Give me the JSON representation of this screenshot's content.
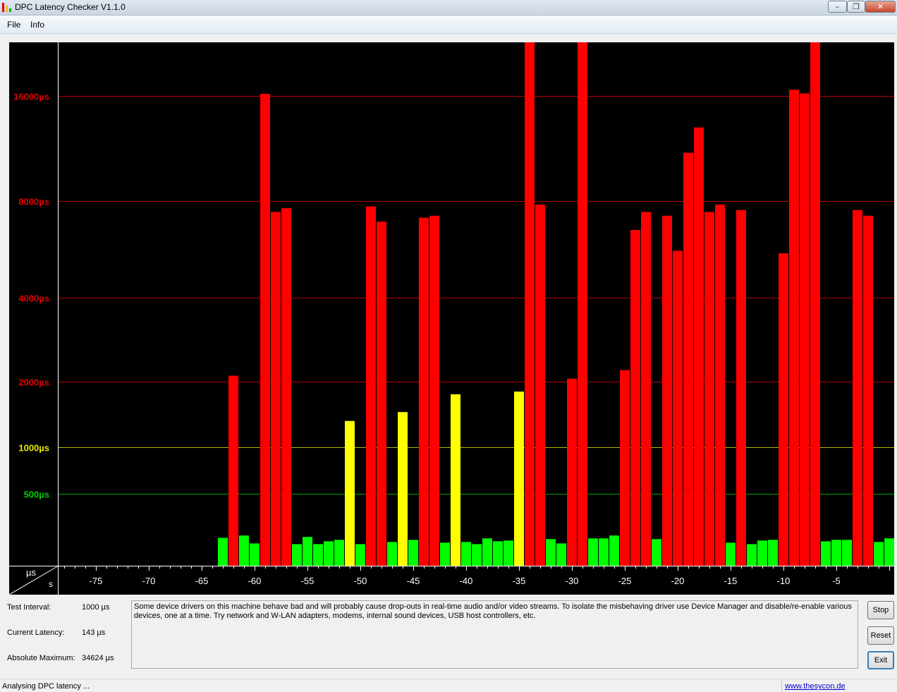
{
  "window": {
    "title": "DPC Latency Checker V1.1.0",
    "minimize_icon": "minimize-icon",
    "maximize_icon": "restore-icon",
    "close_icon": "close-icon"
  },
  "menu": {
    "items": [
      "File",
      "Info"
    ]
  },
  "chart_data": {
    "type": "bar",
    "title": "",
    "xlabel": "s",
    "ylabel": "µs",
    "x_ticks": [
      -75,
      -70,
      -65,
      -60,
      -55,
      -50,
      -45,
      -40,
      -35,
      -30,
      -25,
      -20,
      -15,
      -10,
      -5
    ],
    "y_ticks": [
      {
        "value": 500,
        "label": "500µs",
        "color": "#00cc00"
      },
      {
        "value": 1000,
        "label": "1000µs",
        "color": "#e8e800"
      },
      {
        "value": 2000,
        "label": "2000µs",
        "color": "#e00000"
      },
      {
        "value": 4000,
        "label": "4000µs",
        "color": "#e00000"
      },
      {
        "value": 8000,
        "label": "8000µs",
        "color": "#e00000"
      },
      {
        "value": 16000,
        "label": "16000µs",
        "color": "#e00000"
      }
    ],
    "xlim": [
      -79,
      0
    ],
    "ylim": [
      0,
      34624
    ],
    "grid": true,
    "color_thresholds": {
      "green_max": 1000,
      "yellow_max": 2000,
      "green": "#00ff00",
      "yellow": "#ffff00",
      "red": "#ff0000"
    },
    "x": [
      -63,
      -62,
      -61,
      -60,
      -59,
      -58,
      -57,
      -56,
      -55,
      -54,
      -53,
      -52,
      -51,
      -50,
      -49,
      -48,
      -47,
      -46,
      -45,
      -44,
      -43,
      -42,
      -41,
      -40,
      -39,
      -38,
      -37,
      -36,
      -35,
      -34,
      -33,
      -32,
      -31,
      -30,
      -29,
      -28,
      -27,
      -26,
      -25,
      -24,
      -23,
      -22,
      -21,
      -20,
      -19,
      -18,
      -17,
      -16,
      -15,
      -14,
      -13,
      -12,
      -11,
      -10,
      -9,
      -8,
      -7,
      -6,
      -5,
      -4,
      -3,
      -2,
      -1,
      0
    ],
    "values": [
      194,
      2100,
      210,
      155,
      16500,
      7400,
      7600,
      150,
      200,
      150,
      170,
      180,
      1320,
      150,
      7700,
      6900,
      165,
      1450,
      180,
      7100,
      7200,
      160,
      1750,
      165,
      150,
      190,
      170,
      175,
      1800,
      34624,
      7800,
      185,
      155,
      2050,
      34624,
      190,
      190,
      210,
      2200,
      6500,
      7400,
      185,
      7200,
      5600,
      11000,
      13000,
      7400,
      7800,
      160,
      7500,
      150,
      175,
      180,
      5500,
      17500,
      16600,
      34624,
      170,
      180,
      180,
      7500,
      7200,
      165,
      190
    ]
  },
  "stats": {
    "test_interval_label": "Test Interval:",
    "test_interval_value": "1000 µs",
    "current_latency_label": "Current Latency:",
    "current_latency_value": "143 µs",
    "absolute_maximum_label": "Absolute Maximum:",
    "absolute_maximum_value": "34624 µs"
  },
  "message": "Some device drivers on this machine behave bad and will probably cause drop-outs in real-time audio and/or video streams. To isolate the misbehaving driver use Device Manager and disable/re-enable various devices, one at a time. Try network and W-LAN adapters, modems, internal sound devices, USB host controllers, etc.",
  "buttons": {
    "stop": "Stop",
    "reset": "Reset",
    "exit": "Exit"
  },
  "status": {
    "text": "Analysing DPC latency ...",
    "link": "www.thesycon.de"
  }
}
